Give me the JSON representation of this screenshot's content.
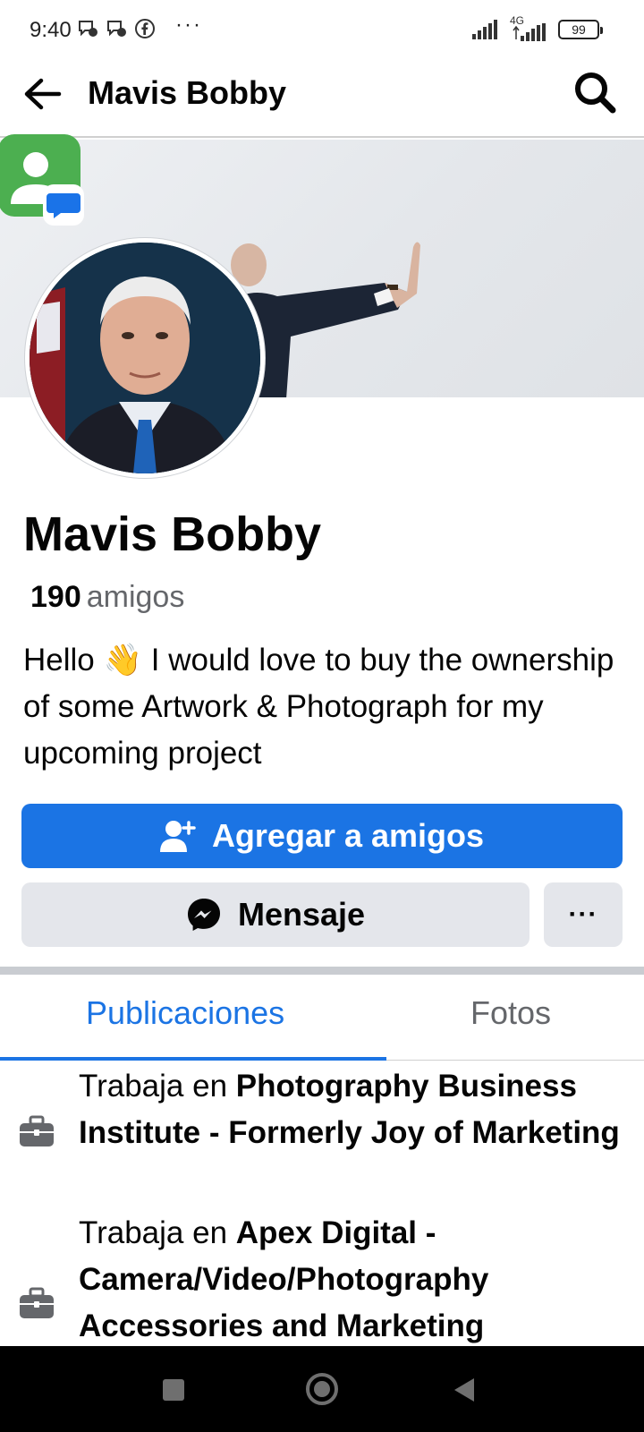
{
  "status_bar": {
    "time": "9:40",
    "more": "···",
    "network": "4G",
    "battery": "99"
  },
  "app_bar": {
    "title": "Mavis Bobby"
  },
  "profile": {
    "name": "Mavis Bobby",
    "friends_count": "190",
    "friends_label": "amigos",
    "bio_before_emoji": "Hello ",
    "bio_emoji": "👋",
    "bio_after_emoji": " I would love to buy the ownership of some Artwork & Photograph for my upcoming project"
  },
  "actions": {
    "add_friend_label": "Agregar a amigos",
    "message_label": "Mensaje",
    "more_label": "···"
  },
  "tabs": [
    {
      "label": "Publicaciones",
      "active": true
    },
    {
      "label": "Fotos",
      "active": false
    }
  ],
  "work": [
    {
      "prefix": "Trabaja en ",
      "company": "Photography Business Institute - Formerly Joy of Marketing"
    },
    {
      "prefix": "Trabaja en ",
      "company": "Apex Digital - Camera/Video/Photography Accessories and Marketing"
    }
  ],
  "colors": {
    "accent": "#1b74e4",
    "button_secondary": "#e4e6eb",
    "text_secondary": "#65676b"
  }
}
